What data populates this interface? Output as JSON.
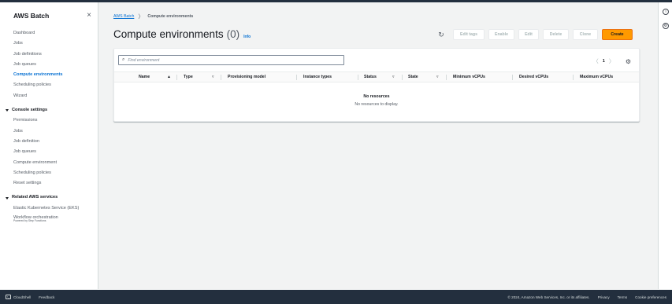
{
  "sidebar": {
    "title": "AWS Batch",
    "close_icon": "×",
    "items": [
      {
        "label": "Dashboard",
        "active": false
      },
      {
        "label": "Jobs",
        "active": false
      },
      {
        "label": "Job definitions",
        "active": false
      },
      {
        "label": "Job queues",
        "active": false
      },
      {
        "label": "Compute environments",
        "active": true
      },
      {
        "label": "Scheduling policies",
        "active": false
      },
      {
        "label": "Wizard",
        "active": false
      }
    ],
    "console_settings": {
      "title": "Console settings",
      "items": [
        "Permissions",
        "Jobs",
        "Job definition",
        "Job queues",
        "Compute environment",
        "Scheduling policies",
        "Reset settings"
      ]
    },
    "related": {
      "title": "Related AWS services",
      "items": [
        {
          "label": "Elastic Kubernetes Service (EKS)",
          "sub": ""
        },
        {
          "label": "Workflow orchestration",
          "sub": "Powered by Step Functions"
        }
      ]
    }
  },
  "breadcrumb": {
    "root": "AWS Batch",
    "separator": "〉",
    "current": "Compute environments"
  },
  "header": {
    "title": "Compute environments",
    "count": "(0)",
    "info": "Info"
  },
  "actions": {
    "refresh_icon": "↻",
    "edit_tags": "Edit tags",
    "enable": "Enable",
    "edit": "Edit",
    "delete": "Delete",
    "clone": "Clone",
    "create": "Create"
  },
  "table": {
    "search_placeholder": "Find environment",
    "pagination": {
      "prev": "〈",
      "page": "1",
      "next": "〉"
    },
    "columns": [
      "Name",
      "Type",
      "Provisioning model",
      "Instance types",
      "Status",
      "State",
      "Minimum vCPUs",
      "Desired vCPUs",
      "Maximum vCPUs"
    ],
    "sort_asc": "▲",
    "sort_filter": "▿",
    "empty_title": "No resources",
    "empty_sub": "No resources to display."
  },
  "footer": {
    "cloudshell": "CloudShell",
    "feedback": "Feedback",
    "copyright": "© 2024, Amazon Web Services, Inc. or its affiliates.",
    "privacy": "Privacy",
    "terms": "Terms",
    "cookies": "Cookie preferences"
  },
  "colors": {
    "accent": "#0972d3",
    "primary_button": "#ff9900",
    "footer_bg": "#232f3e"
  }
}
